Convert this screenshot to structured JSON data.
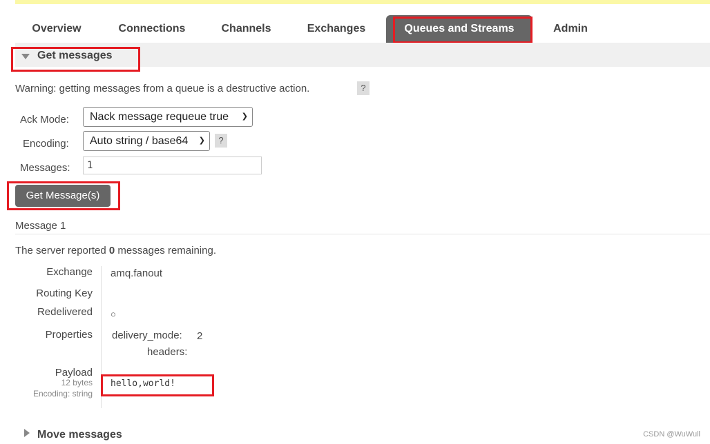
{
  "tabs": [
    {
      "label": "Overview"
    },
    {
      "label": "Connections"
    },
    {
      "label": "Channels"
    },
    {
      "label": "Exchanges"
    },
    {
      "label": "Queues and Streams"
    },
    {
      "label": "Admin"
    }
  ],
  "get_messages": {
    "title": "Get messages",
    "warning": "Warning: getting messages from a queue is a destructive action.",
    "help": "?",
    "ack_mode_label": "Ack Mode:",
    "ack_mode_value": "Nack message requeue true",
    "encoding_label": "Encoding:",
    "encoding_value": "Auto string / base64",
    "messages_label": "Messages:",
    "messages_value": "1",
    "button": "Get Message(s)"
  },
  "message": {
    "heading": "Message 1",
    "remaining_prefix": "The server reported ",
    "remaining_count": "0",
    "remaining_suffix": " messages remaining.",
    "exchange_label": "Exchange",
    "exchange_value": "amq.fanout",
    "routing_key_label": "Routing Key",
    "redelivered_label": "Redelivered",
    "redelivered_value": "○",
    "properties_label": "Properties",
    "prop_delivery_mode_key": "delivery_mode:",
    "prop_delivery_mode_value": "2",
    "prop_headers_key": "headers:",
    "payload_label": "Payload",
    "payload_size": "12 bytes",
    "payload_encoding": "Encoding: string",
    "payload_value": "hello,world!"
  },
  "move_messages": {
    "title": "Move messages"
  },
  "watermark": "CSDN @WuWull",
  "colors": {
    "highlight": "#e51c23",
    "active_tab": "#666666",
    "topbar": "#fbf8a6"
  }
}
